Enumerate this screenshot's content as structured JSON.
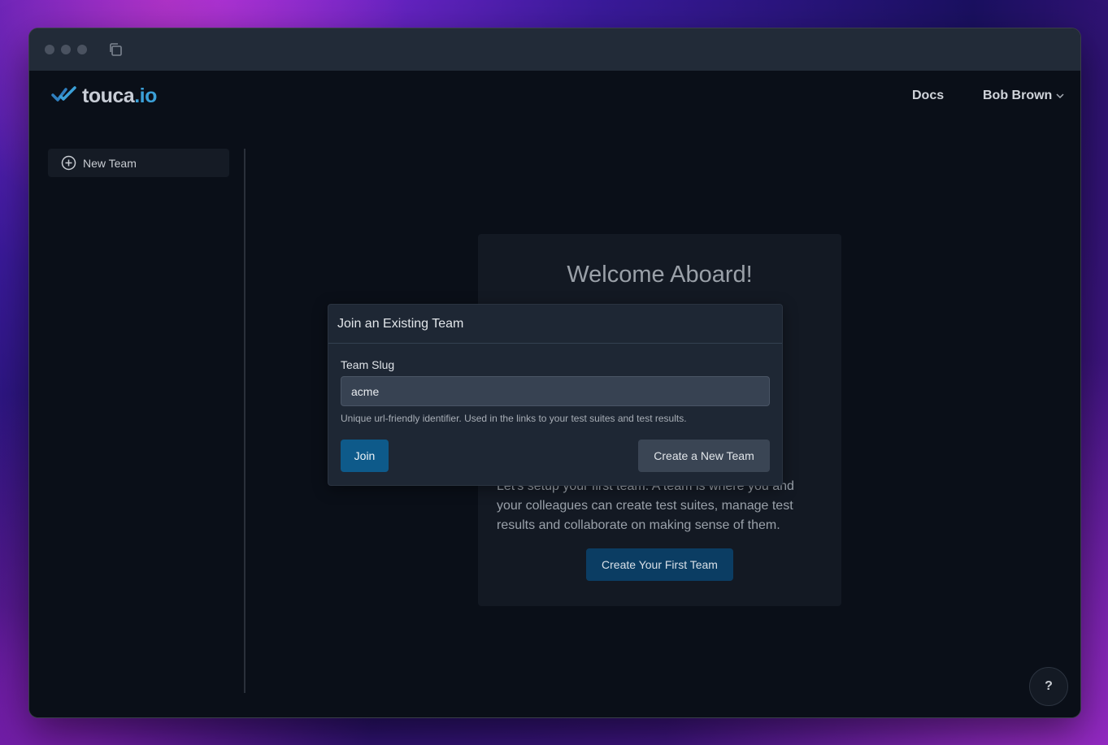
{
  "header": {
    "logo_text": "touca",
    "logo_suffix": ".io",
    "docs_label": "Docs",
    "user_name": "Bob Brown"
  },
  "sidebar": {
    "new_team_label": "New Team"
  },
  "welcome": {
    "title": "Welcome Aboard!",
    "text": "Let's setup your first team. A team is where you and your colleagues can create test suites, manage test results and collaborate on making sense of them.",
    "cta_label": "Create Your First Team"
  },
  "modal": {
    "title": "Join an Existing Team",
    "field_label": "Team Slug",
    "slug_value": "acme",
    "help_text": "Unique url-friendly identifier. Used in the links to your test suites and test results.",
    "join_label": "Join",
    "create_label": "Create a New Team"
  },
  "help_fab_label": "?",
  "colors": {
    "accent": "#0e5a8a",
    "brand": "#3ba0d8",
    "background": "#0a0f18"
  }
}
